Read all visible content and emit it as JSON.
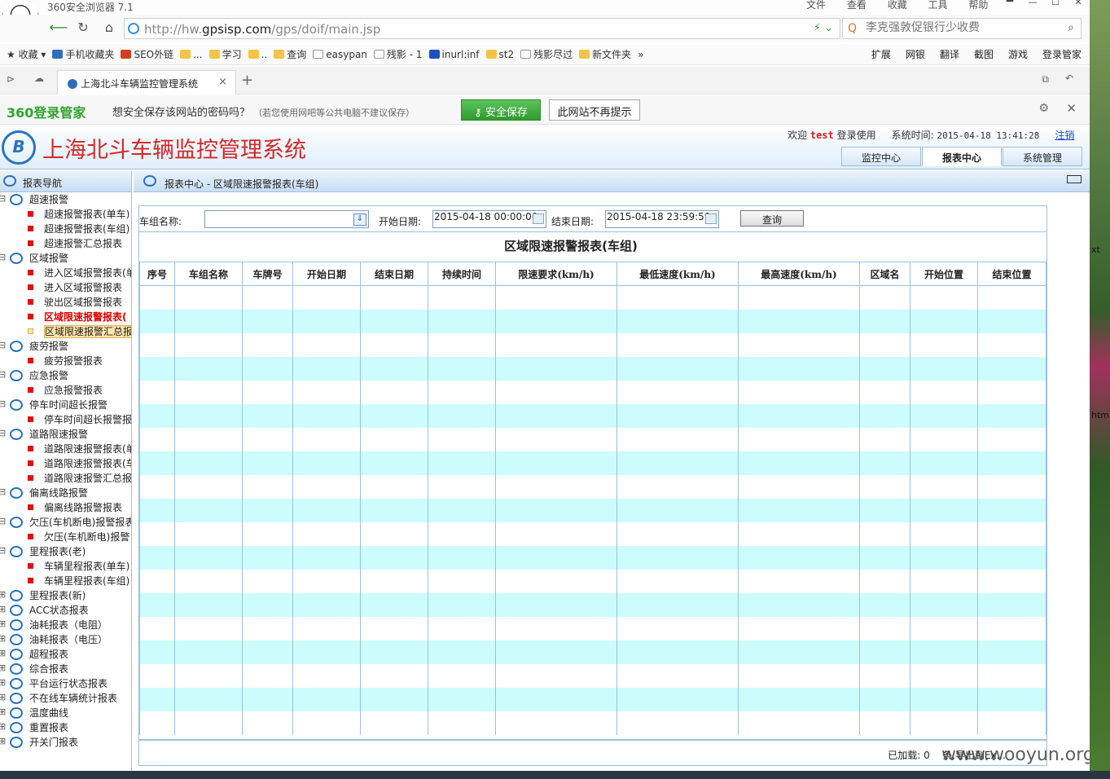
{
  "browser": {
    "title": "360安全浏览器 7.1",
    "menus": [
      "文件",
      "查看",
      "收藏",
      "工具",
      "帮助"
    ],
    "url_prefix": "http://hw.",
    "url_domain": "gpsisp.com",
    "url_path": "/gps/doif/main.jsp",
    "search_placeholder": "李克强敦促银行少收费",
    "tab_title": "上海北斗车辆监控管理系统",
    "bookmarks": [
      "收藏",
      "手机收藏夹",
      "SEO外链",
      "...",
      "学习",
      "..",
      "查询",
      "easypan",
      "残影 - 1",
      "inurl:inf",
      "st2",
      "残影尽过",
      "新文件夹"
    ],
    "toolbar_right": [
      "扩展",
      "网银",
      "翻译",
      "截图",
      "游戏",
      "登录管家"
    ]
  },
  "password_bar": {
    "brand": "360登录管家",
    "message": "想安全保存该网站的密码吗？",
    "hint": "（若您使用网吧等公共电脑不建议保存）",
    "save_label": "安全保存",
    "no_prompt_label": "此网站不再提示"
  },
  "app": {
    "title": "上海北斗车辆监控管理系统",
    "welcome_prefix": "欢迎",
    "user": "test",
    "welcome_suffix": "登录使用",
    "time_label": "系统时间:",
    "time_value": "2015-04-18 13:41:28",
    "logout": "注销",
    "nav": [
      "监控中心",
      "报表中心",
      "系统管理"
    ]
  },
  "sidebar": {
    "header": "报表导航",
    "tree": [
      {
        "label": "超速报警",
        "children": [
          "超速报警报表(单车)",
          "超速报警报表(车组)",
          "超速报警汇总报表"
        ]
      },
      {
        "label": "区域报警",
        "children": [
          "进入区域报警报表(单",
          "进入区域报警报表",
          "驶出区域报警报表",
          "区域限速报警报表(",
          "区域限速报警汇总报"
        ]
      },
      {
        "label": "疲劳报警",
        "children": [
          "疲劳报警报表"
        ]
      },
      {
        "label": "应急报警",
        "children": [
          "应急报警报表"
        ]
      },
      {
        "label": "停车时间超长报警",
        "children": [
          "停车时间超长报警报"
        ]
      },
      {
        "label": "道路限速报警",
        "children": [
          "道路限速报警报表(单",
          "道路限速报警报表(车",
          "道路限速报警汇总报"
        ]
      },
      {
        "label": "偏离线路报警",
        "children": [
          "偏离线路报警报表"
        ]
      },
      {
        "label": "欠压(车机断电)报警报表",
        "children": [
          "欠压(车机断电)报警"
        ]
      },
      {
        "label": "里程报表(老)",
        "children": [
          "车辆里程报表(单车)",
          "车辆里程报表(车组)"
        ]
      },
      {
        "label": "里程报表(新)",
        "children": []
      },
      {
        "label": "ACC状态报表",
        "children": []
      },
      {
        "label": "油耗报表（电阻）",
        "children": []
      },
      {
        "label": "油耗报表（电压）",
        "children": []
      },
      {
        "label": "超程报表",
        "children": []
      },
      {
        "label": "综合报表",
        "children": []
      },
      {
        "label": "平台运行状态报表",
        "children": []
      },
      {
        "label": "不在线车辆统计报表",
        "children": []
      },
      {
        "label": "温度曲线",
        "children": []
      },
      {
        "label": "重置报表",
        "children": []
      },
      {
        "label": "开关门报表",
        "children": []
      }
    ]
  },
  "content": {
    "breadcrumb": "报表中心 - 区域限速报警报表(车组)",
    "filters": {
      "group_label": "车组名称:",
      "group_value": "",
      "start_label": "开始日期:",
      "start_value": "2015-04-18 00:00:00",
      "end_label": "结束日期:",
      "end_value": "2015-04-18 23:59:59",
      "query_label": "查询"
    },
    "report_title": "区域限速报警报表(车组)",
    "columns": [
      "序号",
      "车组名称",
      "车牌号",
      "开始日期",
      "结束日期",
      "持续时间",
      "限速要求(km/h)",
      "最低速度(km/h)",
      "最高速度(km/h)",
      "区域名",
      "开始位置",
      "结束位置"
    ],
    "empty_rows": 19,
    "pager_loaded": "已加载: 0",
    "pager_unit": "条",
    "pager_export": "导出到Ex...",
    "watermark": "www.wooyun.org"
  },
  "desktop": {
    "label_1": "xt",
    "label_2": "html"
  }
}
